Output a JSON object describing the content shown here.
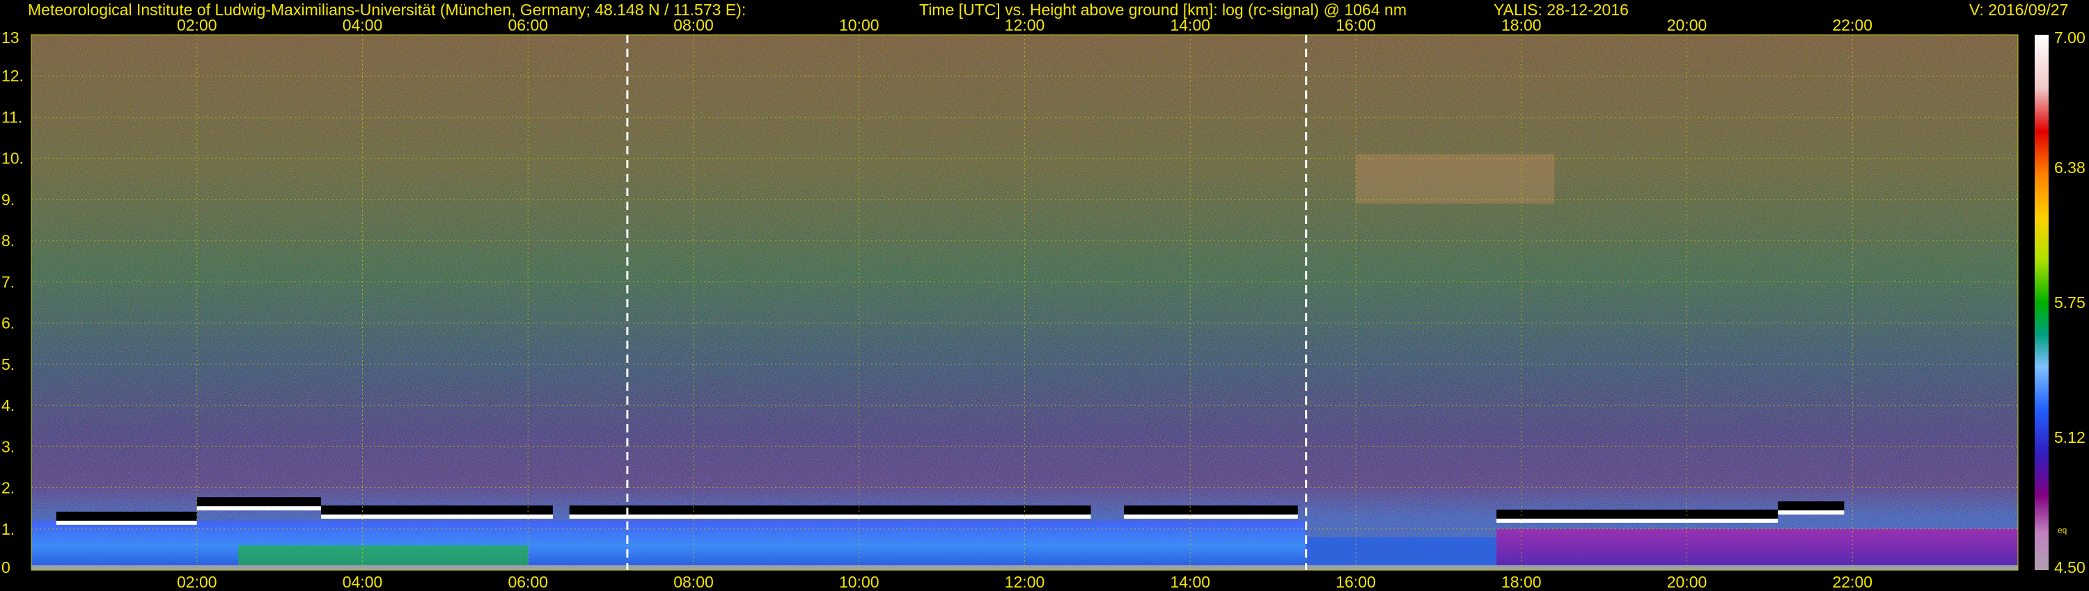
{
  "header": {
    "institute": "Meteorological Institute of Ludwig-Maximilians-Universität (München, Germany; 48.148 N / 11.573 E):",
    "axes_description": "Time [UTC] vs. Height above ground [km]: log (rc-signal) @ 1064 nm",
    "instrument_date": "YALIS: 28-12-2016",
    "version": "V: 2016/09/27"
  },
  "chart_data": {
    "type": "heatmap",
    "title": "Time [UTC] vs. Height above ground [km]: log (rc-signal) @ 1064 nm",
    "xlabel": "Time [UTC]",
    "ylabel": "Height above ground [km]",
    "x_range_hours": [
      0,
      24
    ],
    "x_ticks": [
      "02:00",
      "04:00",
      "06:00",
      "08:00",
      "10:00",
      "12:00",
      "14:00",
      "16:00",
      "18:00",
      "20:00",
      "22:00"
    ],
    "x_tick_hours": [
      2,
      4,
      6,
      8,
      10,
      12,
      14,
      16,
      18,
      20,
      22
    ],
    "ylim": [
      0,
      13
    ],
    "y_ticks": [
      "0",
      "1.",
      "2.",
      "3.",
      "4.",
      "5.",
      "6.",
      "7.",
      "8.",
      "9.",
      "10.",
      "11.",
      "12.",
      "13"
    ],
    "y_tick_values": [
      0,
      1,
      2,
      3,
      4,
      5,
      6,
      7,
      8,
      9,
      10,
      11,
      12,
      13
    ],
    "grid": true,
    "vertical_markers_hours": [
      7.2,
      15.4
    ],
    "colorbar": {
      "range": [
        4.5,
        7.0
      ],
      "tick_labels": [
        "7.00",
        "6.38",
        "5.75",
        "5.12",
        "4.50"
      ],
      "tick_values": [
        7.0,
        6.38,
        5.75,
        5.12,
        4.5
      ],
      "small_label": "eq"
    },
    "cloud_layers": [
      {
        "name": "boundary layer top",
        "segments": [
          {
            "start": 0.3,
            "end": 2.0,
            "height_km": 1.2
          },
          {
            "start": 2.0,
            "end": 3.5,
            "height_km": 1.55
          },
          {
            "start": 3.5,
            "end": 6.3,
            "height_km": 1.35
          },
          {
            "start": 6.5,
            "end": 12.8,
            "height_km": 1.35
          },
          {
            "start": 13.2,
            "end": 15.3,
            "height_km": 1.35
          },
          {
            "start": 17.7,
            "end": 21.1,
            "height_km": 1.25
          },
          {
            "start": 21.1,
            "end": 21.9,
            "height_km": 1.45
          }
        ]
      },
      {
        "name": "cirrus",
        "segments": [
          {
            "start": 16.0,
            "end": 18.4,
            "height_km": 9.5
          }
        ]
      }
    ],
    "colors": {
      "font": "#f3e600",
      "marker": "#ffffff",
      "grid": "#c8c800"
    }
  }
}
